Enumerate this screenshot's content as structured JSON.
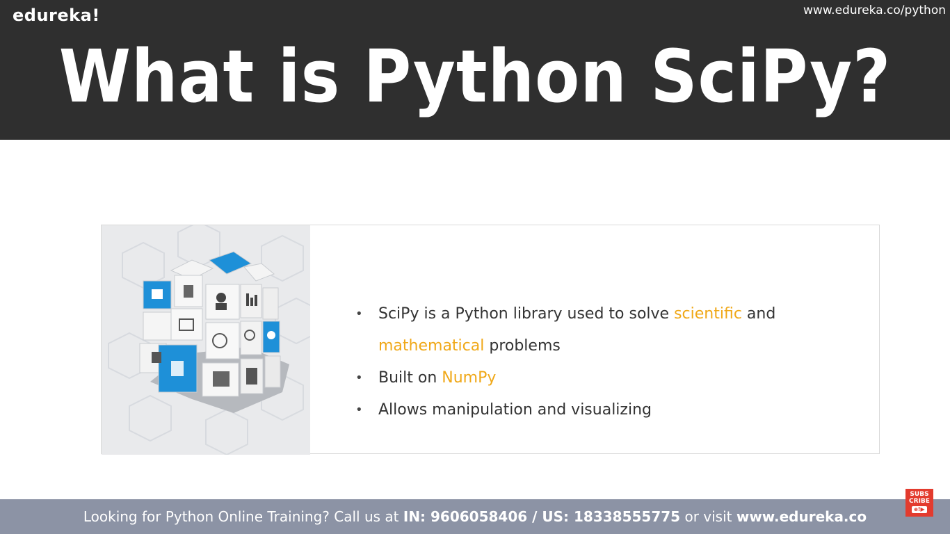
{
  "header": {
    "logo": "edureka!",
    "url": "www.edureka.co/python",
    "title": "What is Python SciPy?"
  },
  "content": {
    "image": {
      "icon": "rubiks-cube-icons-illustration"
    },
    "bullets": [
      {
        "parts": [
          "SciPy is a Python library used to solve ",
          "scientific",
          " and"
        ],
        "line2": [
          "mathematical",
          " problems"
        ]
      },
      {
        "parts": [
          "Built on ",
          "NumPy"
        ]
      },
      {
        "parts": [
          "Allows manipulation and visualizing"
        ]
      }
    ]
  },
  "footer": {
    "prefix": "Looking for Python Online Training? Call us at ",
    "in_label": "IN: 9606058406 / US: 18338555775",
    "middle": " or visit ",
    "site": "www.edureka.co"
  },
  "subscribe": {
    "line1": "SUBS",
    "line2": "CRIBE",
    "badge": "e!▶"
  },
  "colors": {
    "header_bg": "#2f2f2f",
    "highlight": "#f0a818",
    "footer_bg": "#8c93a5",
    "subscribe": "#e33b2e",
    "cube_blue": "#1e90d8"
  }
}
